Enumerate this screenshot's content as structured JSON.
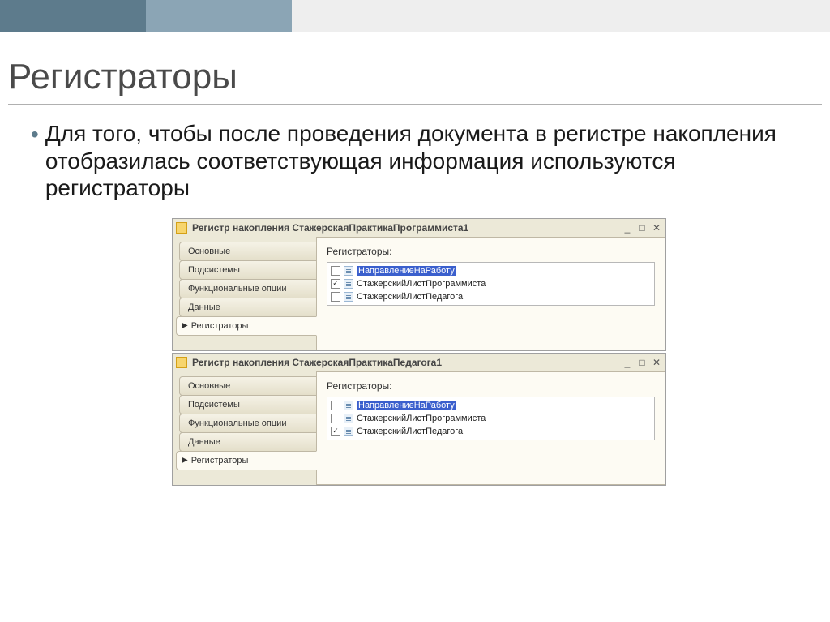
{
  "slide": {
    "title": "Регистраторы",
    "bullet": "Для того, чтобы после проведения документа в регистре накопления отобразилась соответствующая информация используются регистраторы"
  },
  "windows": {
    "w1": {
      "title": "Регистр накопления СтажерскаяПрактикаПрограммиста1",
      "tabs": {
        "t1": "Основные",
        "t2": "Подсистемы",
        "t3": "Функциональные опции",
        "t4": "Данные",
        "t5": "Регистраторы"
      },
      "sectionLabel": "Регистраторы:",
      "items": {
        "i1": "НаправлениеНаРаботу",
        "i2": "СтажерскийЛистПрограммиста",
        "i3": "СтажерскийЛистПедагога"
      },
      "checked": {
        "i1": false,
        "i2": true,
        "i3": false
      },
      "selected": "i1"
    },
    "w2": {
      "title": "Регистр накопления СтажерскаяПрактикаПедагога1",
      "tabs": {
        "t1": "Основные",
        "t2": "Подсистемы",
        "t3": "Функциональные опции",
        "t4": "Данные",
        "t5": "Регистраторы"
      },
      "sectionLabel": "Регистраторы:",
      "items": {
        "i1": "НаправлениеНаРаботу",
        "i2": "СтажерскийЛистПрограммиста",
        "i3": "СтажерскийЛистПедагога"
      },
      "checked": {
        "i1": false,
        "i2": false,
        "i3": true
      },
      "selected": "i1"
    }
  }
}
